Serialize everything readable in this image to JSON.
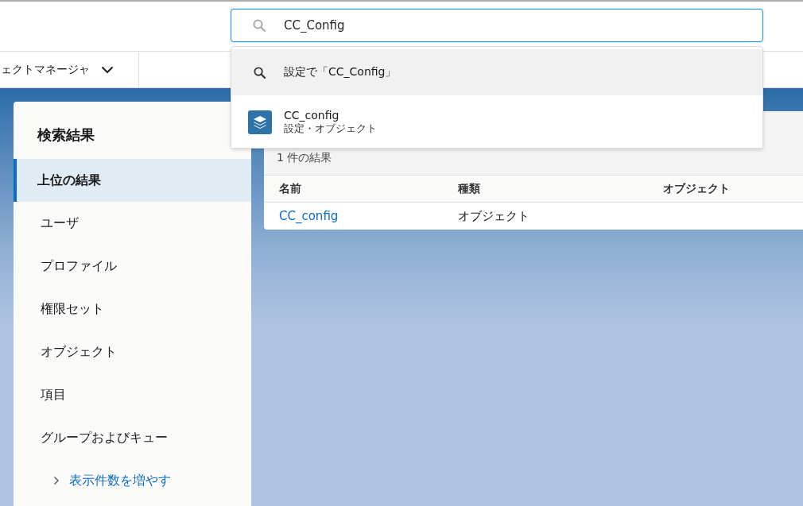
{
  "search": {
    "value": "CC_Config"
  },
  "suggestions": [
    {
      "kind": "search",
      "title": "設定で「CC_Config」",
      "selected": true
    },
    {
      "kind": "object",
      "title": "CC_config",
      "subtitle": "設定・オブジェクト",
      "selected": false
    }
  ],
  "nav": {
    "app_name": "ェクトマネージャ"
  },
  "sidebar": {
    "title": "検索結果",
    "items": [
      {
        "label": "上位の結果",
        "selected": true
      },
      {
        "label": "ユーザ",
        "selected": false
      },
      {
        "label": "プロファイル",
        "selected": false
      },
      {
        "label": "権限セット",
        "selected": false
      },
      {
        "label": "オブジェクト",
        "selected": false
      },
      {
        "label": "項目",
        "selected": false
      },
      {
        "label": "グループおよびキュー",
        "selected": false
      }
    ],
    "more_link": "表示件数を増やす"
  },
  "results": {
    "count": "1 件の結果",
    "columns": [
      "名前",
      "種類",
      "オブジェクト"
    ],
    "rows": [
      {
        "cells": [
          {
            "text": "CC_config",
            "kind": "link"
          },
          {
            "text": "オブジェクト",
            "kind": "text"
          }
        ]
      }
    ]
  }
}
